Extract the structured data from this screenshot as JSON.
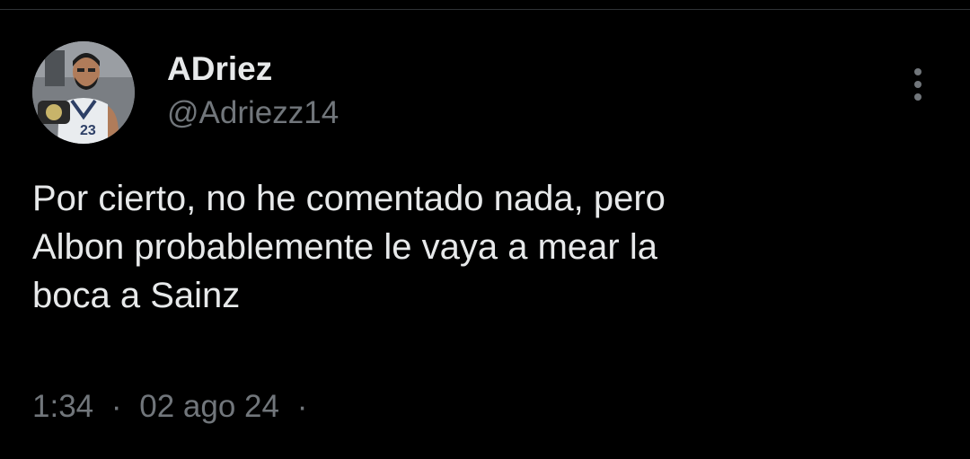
{
  "tweet": {
    "author": {
      "display_name": "ADriez",
      "handle": "@Adriezz14",
      "avatar_icon": "avatar-photo"
    },
    "text_lines": [
      "Por cierto, no he comentado nada, pero",
      "Albon probablemente le vaya a mear la",
      "boca a Sainz"
    ],
    "time": "1:34",
    "separator": "·",
    "date": "02 ago 24",
    "trailing_separator": "·",
    "more_icon": "more-options-icon"
  },
  "colors": {
    "background": "#000000",
    "primary_text": "#e7e9ea",
    "secondary_text": "#71767b",
    "divider": "#2f3336"
  }
}
